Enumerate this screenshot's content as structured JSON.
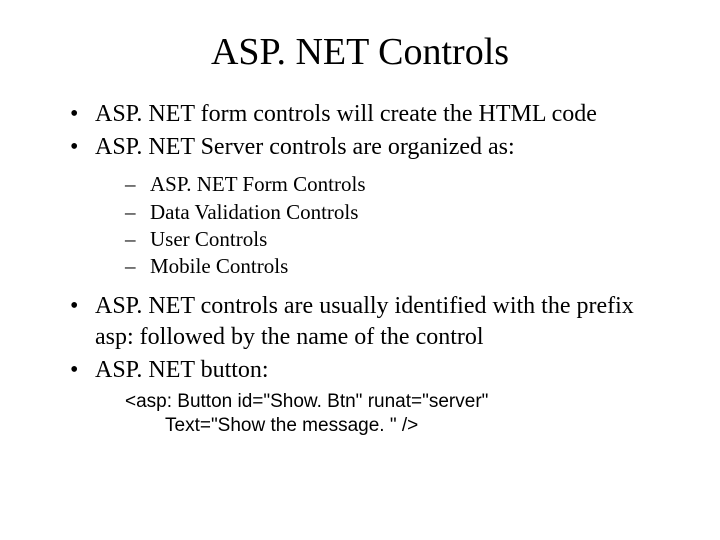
{
  "title": "ASP. NET Controls",
  "bullets": {
    "b1": "ASP. NET form controls will create the HTML code",
    "b2": "ASP. NET Server controls are organized as:",
    "b2_sub": {
      "s1": "ASP. NET Form Controls",
      "s2": "Data Validation Controls",
      "s3": "User Controls",
      "s4": "Mobile Controls"
    },
    "b3": "ASP. NET controls are usually identified with the prefix asp: followed by the name of the control",
    "b4": "ASP. NET button:",
    "b4_code": {
      "line1": "<asp: Button id=\"Show. Btn\" runat=\"server\"",
      "line2": "Text=\"Show the message. \" />"
    }
  }
}
